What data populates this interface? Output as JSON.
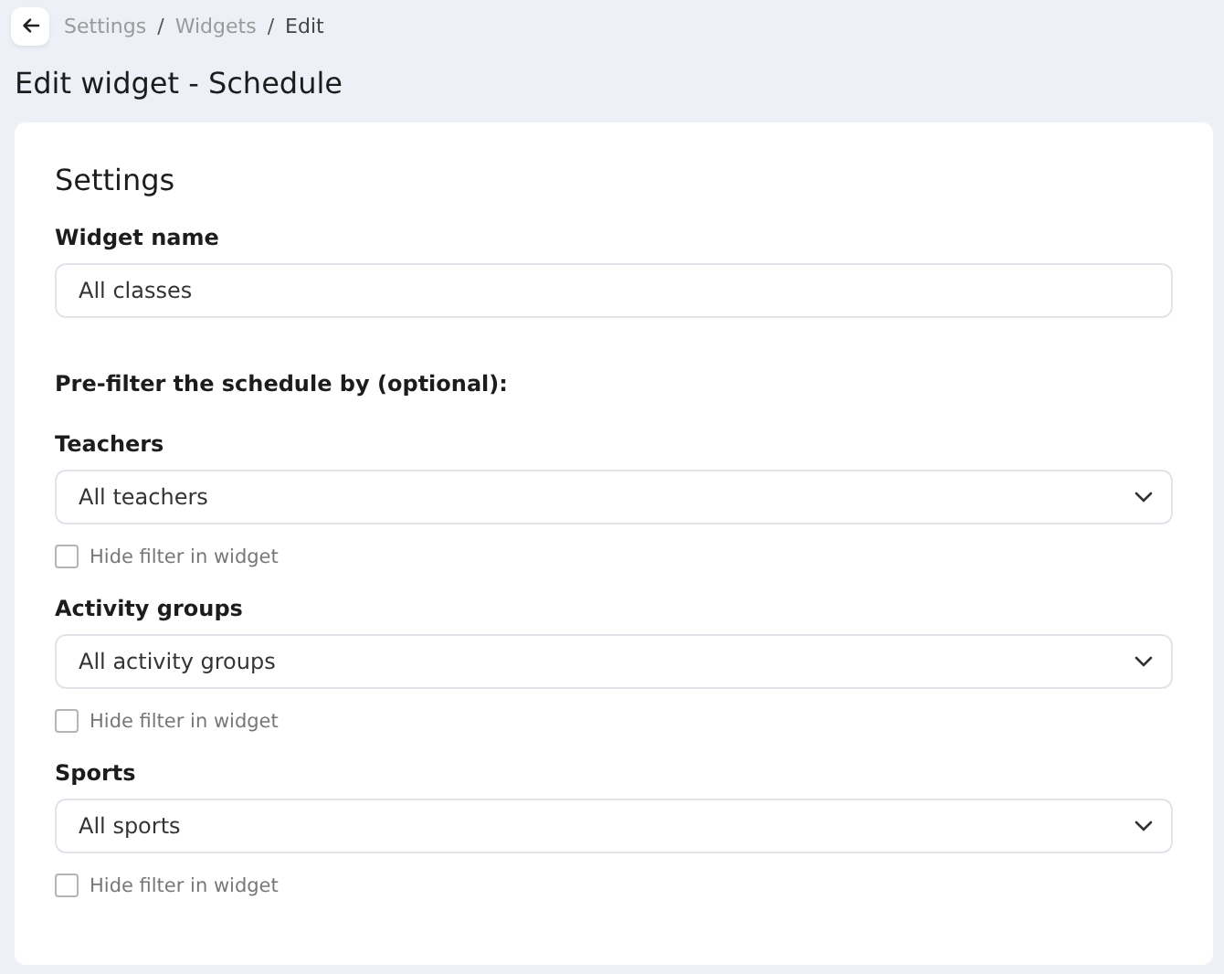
{
  "breadcrumb": [
    {
      "label": "Settings",
      "current": false
    },
    {
      "label": "Widgets",
      "current": false
    },
    {
      "label": "Edit",
      "current": true
    }
  ],
  "breadcrumb_separator": "/",
  "page_title": "Edit widget - Schedule",
  "card": {
    "heading": "Settings",
    "widget_name": {
      "label": "Widget name",
      "value": "All classes"
    },
    "prefilter_heading": "Pre-filter the schedule by (optional):",
    "filters": [
      {
        "label": "Teachers",
        "value": "All teachers",
        "hide_label": "Hide filter in widget",
        "checked": false
      },
      {
        "label": "Activity groups",
        "value": "All activity groups",
        "hide_label": "Hide filter in widget",
        "checked": false
      },
      {
        "label": "Sports",
        "value": "All sports",
        "hide_label": "Hide filter in widget",
        "checked": false
      }
    ]
  }
}
